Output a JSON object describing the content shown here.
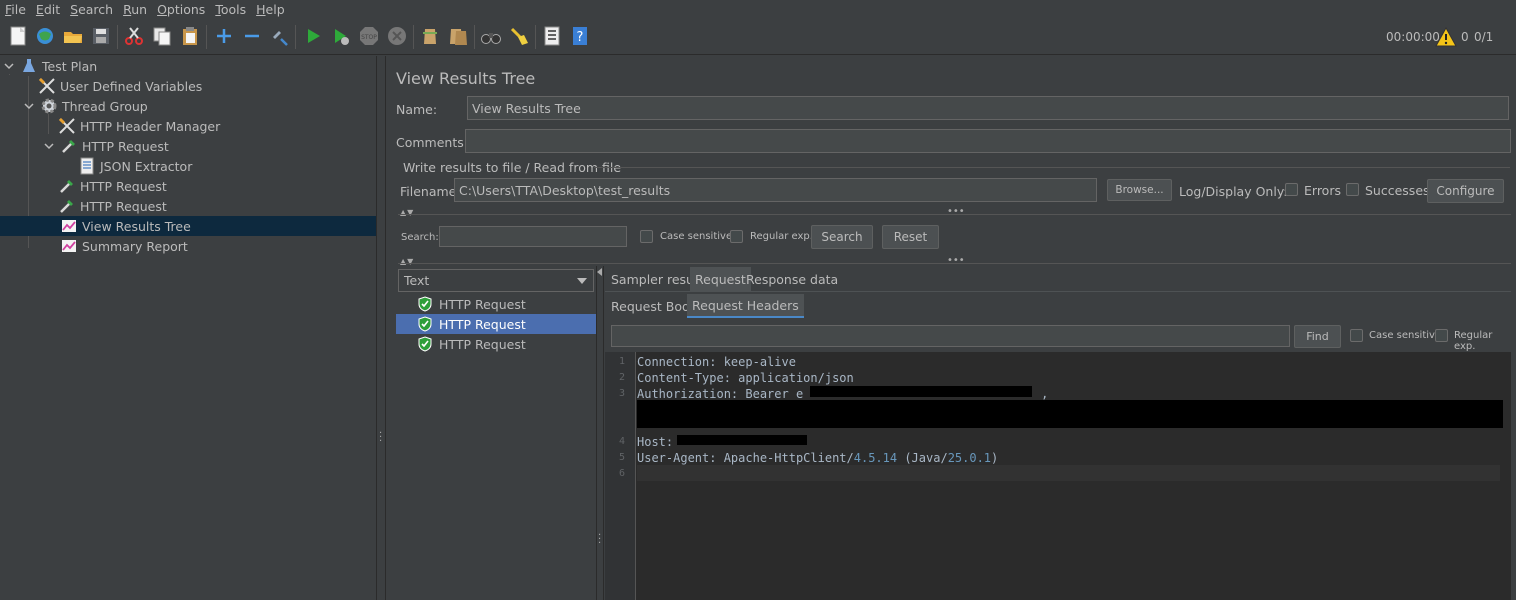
{
  "menu": [
    {
      "label": "File",
      "mnemonic": "F",
      "rest": "ile"
    },
    {
      "label": "Edit",
      "mnemonic": "E",
      "rest": "dit"
    },
    {
      "label": "Search",
      "mnemonic": "S",
      "rest": "earch"
    },
    {
      "label": "Run",
      "mnemonic": "R",
      "rest": "un"
    },
    {
      "label": "Options",
      "mnemonic": "O",
      "rest": "ptions"
    },
    {
      "label": "Tools",
      "mnemonic": "T",
      "rest": "ools"
    },
    {
      "label": "Help",
      "mnemonic": "H",
      "rest": "elp"
    }
  ],
  "status": {
    "elapsed": "00:00:00",
    "error_count": "0",
    "threads": "0/1"
  },
  "tree": {
    "items": [
      {
        "label": "Test Plan",
        "icon": "flask-icon",
        "expanded": true
      },
      {
        "label": "User Defined Variables",
        "icon": "wrench-icon"
      },
      {
        "label": "Thread Group",
        "icon": "gear-icon",
        "expanded": true
      },
      {
        "label": "HTTP Header Manager",
        "icon": "wrench-icon"
      },
      {
        "label": "HTTP Request",
        "icon": "pipette-icon",
        "expanded": true
      },
      {
        "label": "JSON Extractor",
        "icon": "document-icon"
      },
      {
        "label": "HTTP Request",
        "icon": "pipette-icon"
      },
      {
        "label": "HTTP Request",
        "icon": "pipette-icon"
      },
      {
        "label": "View Results Tree",
        "icon": "graph-icon",
        "selected": true
      },
      {
        "label": "Summary Report",
        "icon": "graph-icon"
      }
    ]
  },
  "panel": {
    "title": "View Results Tree",
    "name_label": "Name:",
    "name_value": "View Results Tree",
    "comments_label": "Comments:",
    "comments_value": "",
    "file_section_label": "Write results to file / Read from file",
    "filename_label": "Filename",
    "filename_value": "C:\\Users\\TTA\\Desktop\\test_results",
    "browse_label": "Browse...",
    "log_display_label": "Log/Display Only:",
    "errors_label": "Errors",
    "successes_label": "Successes",
    "configure_label": "Configure"
  },
  "search": {
    "label": "Search:",
    "value": "",
    "case_sensitive_label": "Case sensitive",
    "regex_label": "Regular exp.",
    "search_button": "Search",
    "reset_button": "Reset"
  },
  "results": {
    "renderer": "Text",
    "items": [
      {
        "label": "HTTP Request",
        "status": "success"
      },
      {
        "label": "HTTP Request",
        "status": "success",
        "selected": true
      },
      {
        "label": "HTTP Request",
        "status": "success"
      }
    ]
  },
  "tabs": {
    "main": [
      "Sampler result",
      "Request",
      "Response data"
    ],
    "main_active": "Request",
    "sub": [
      "Request Body",
      "Request Headers"
    ],
    "sub_active": "Request Headers"
  },
  "find": {
    "value": "",
    "find_button": "Find",
    "case_sensitive_label": "Case sensitive",
    "regex_label": "Regular exp."
  },
  "editor": {
    "line_numbers": [
      "1",
      "2",
      "3",
      "4",
      "5",
      "6"
    ],
    "line1": "Connection: keep-alive",
    "line2": "Content-Type: application/json",
    "line3_prefix": "Authorization: Bearer e",
    "line3_suffix": ",",
    "line4_prefix": "Host: ",
    "line5_prefix": "User-Agent: Apache-HttpClient/",
    "line5_version1": "4.5.14",
    "line5_mid": " (Java/",
    "line5_version2": "25.0.1",
    "line5_suffix": ")"
  },
  "colors": {
    "background": "#3c3f41",
    "editor_bg": "#2b2b2b",
    "selection": "#4b6eaf",
    "tree_selection": "#0d293e",
    "number_literal": "#6897bb",
    "success_green": "#2e9e3a"
  }
}
